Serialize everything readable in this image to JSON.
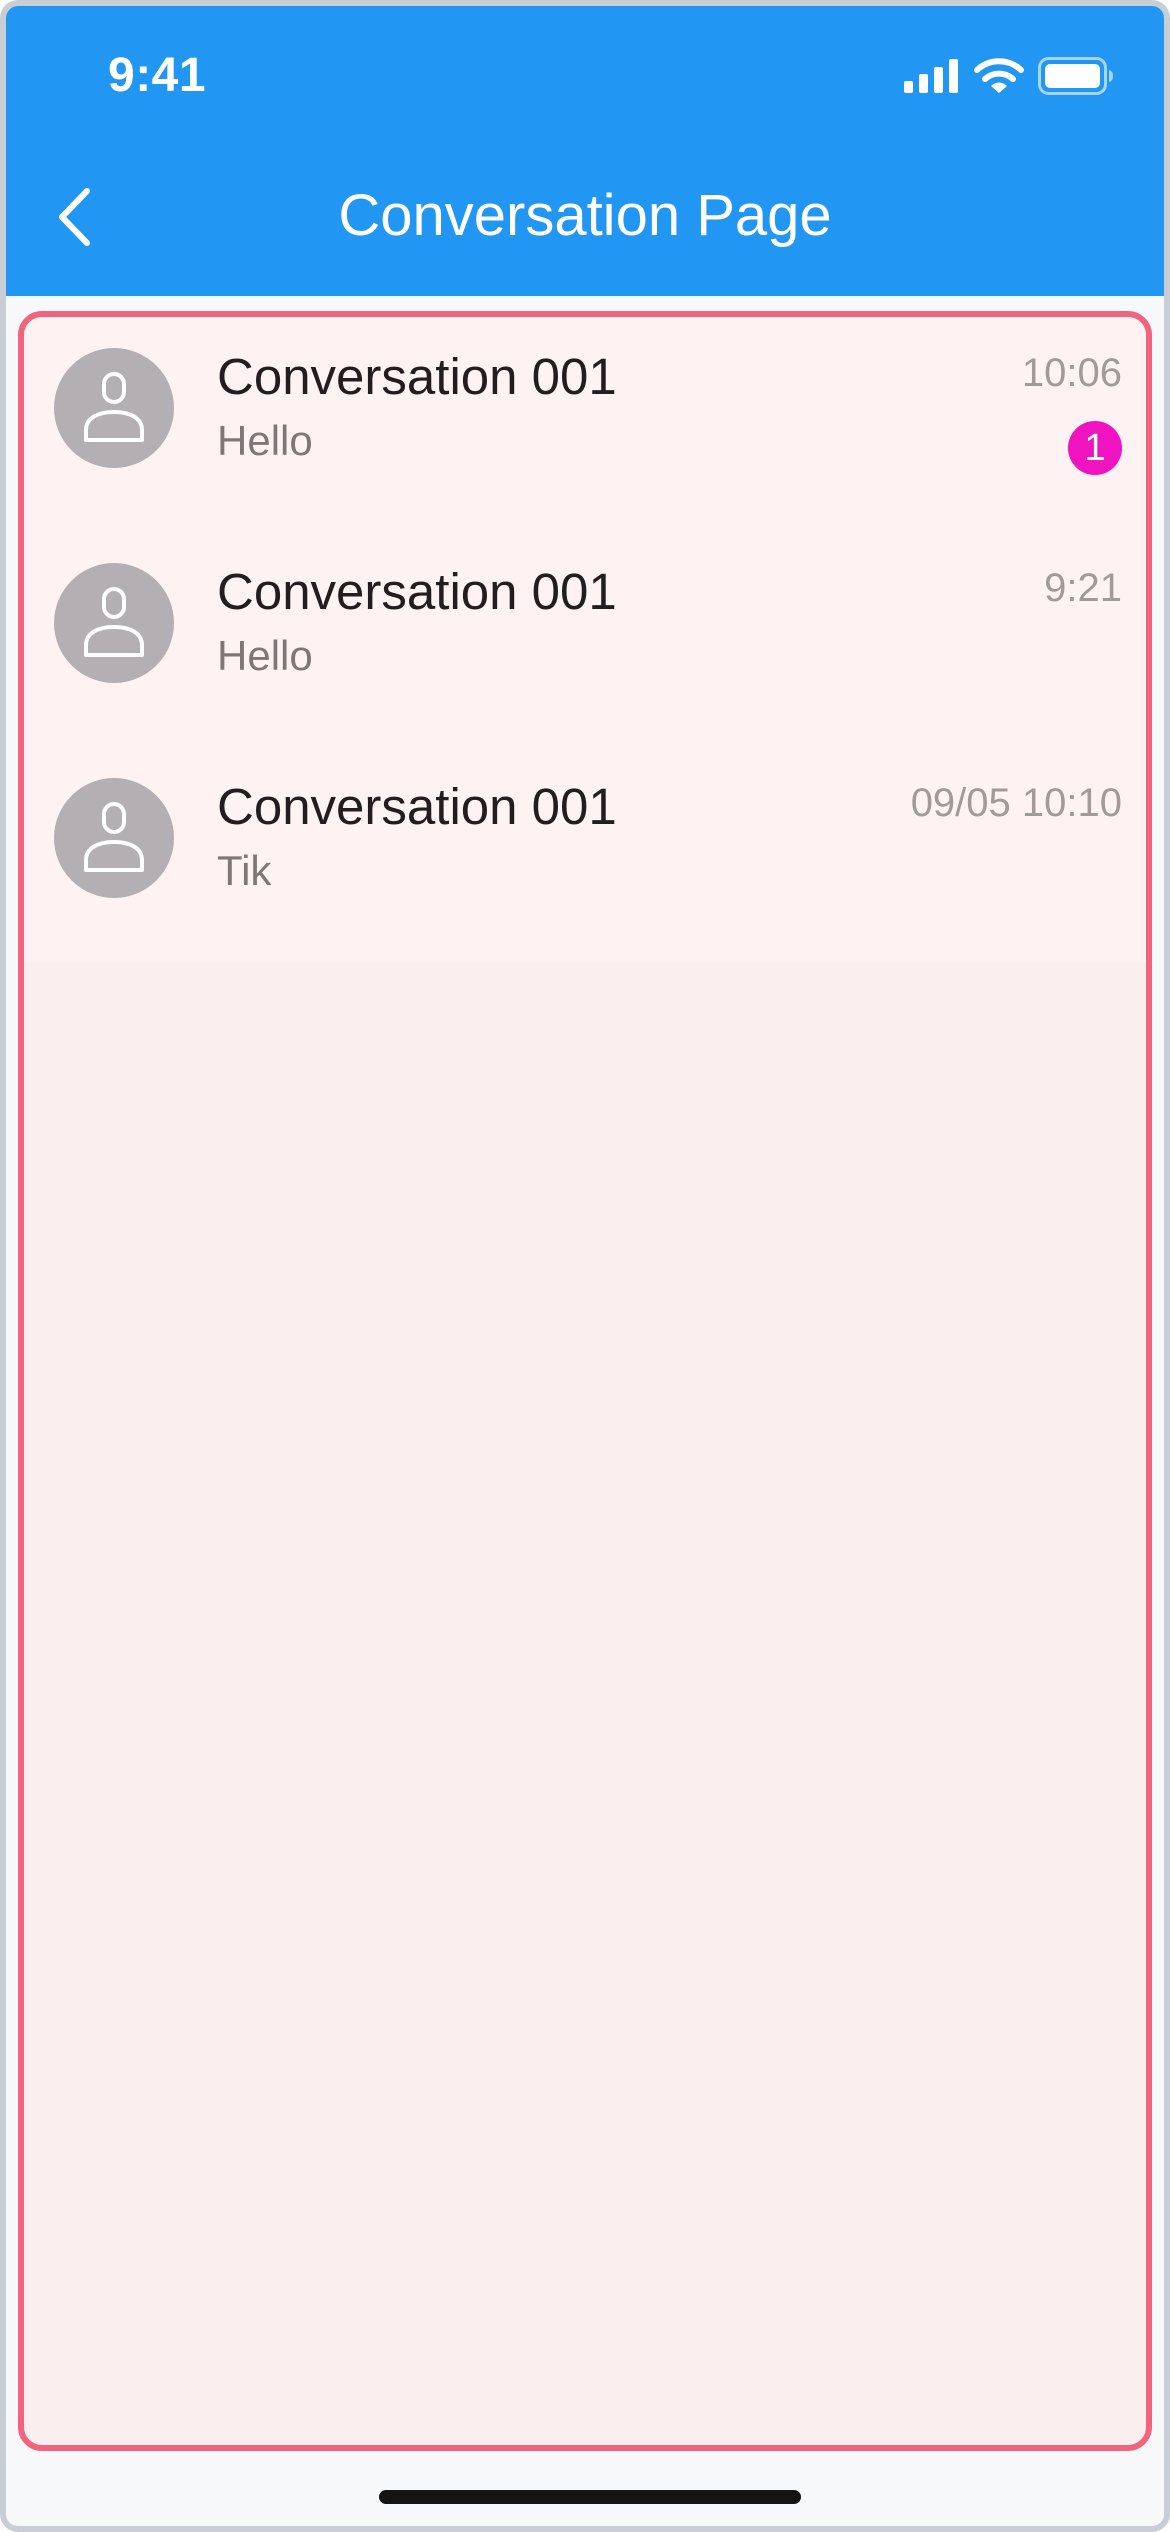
{
  "status_bar": {
    "time": "9:41"
  },
  "nav": {
    "title": "Conversation Page",
    "back_icon": "chevron-left-icon"
  },
  "colors": {
    "header_bg": "#2196f3",
    "highlight_border": "#f2647e",
    "list_bg": "#fef3f2",
    "empty_bg": "#fbeeee",
    "badge_bg": "#f014c0",
    "avatar_bg": "#b3afb3"
  },
  "conversations": [
    {
      "title": "Conversation 001",
      "preview": "Hello",
      "time": "10:06",
      "unread": "1",
      "avatar_icon": "person-icon"
    },
    {
      "title": "Conversation 001",
      "preview": "Hello",
      "time": "9:21",
      "avatar_icon": "person-icon"
    },
    {
      "title": "Conversation 001",
      "preview": "Tik",
      "time": "09/05 10:10",
      "avatar_icon": "person-icon"
    }
  ]
}
